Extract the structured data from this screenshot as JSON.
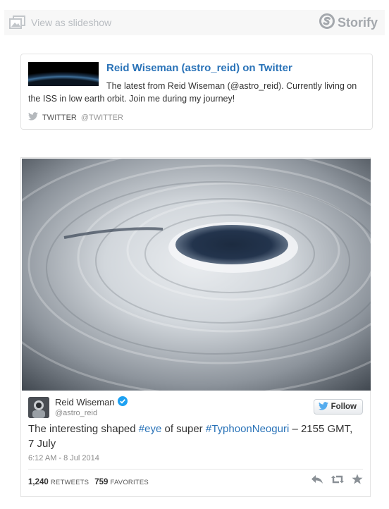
{
  "toolbar": {
    "slideshow_label": "View as slideshow",
    "brand": "Storify"
  },
  "profile_card": {
    "title": "Reid Wiseman (astro_reid) on Twitter",
    "description": "The latest from Reid Wiseman (@astro_reid). Currently living on the ISS in low earth orbit. Join me during my journey!",
    "source_name": "TWITTER",
    "source_handle": "@TWITTER"
  },
  "tweet": {
    "author_name": "Reid Wiseman",
    "author_handle": "@astro_reid",
    "follow_label": "Follow",
    "text_pre": "The interesting shaped ",
    "hashtag1": "#eye",
    "text_mid": " of super ",
    "hashtag2": "#TyphoonNeoguri",
    "text_post": " – 2155 GMT, 7 July",
    "timestamp": "6:12 AM - 8 Jul 2014",
    "retweets_count": "1,240",
    "retweets_label": "RETWEETS",
    "favorites_count": "759",
    "favorites_label": "FAVORITES"
  },
  "colors": {
    "link": "#2a73b8",
    "verified": "#1da1f2",
    "twitter_bird": "#55acee"
  }
}
